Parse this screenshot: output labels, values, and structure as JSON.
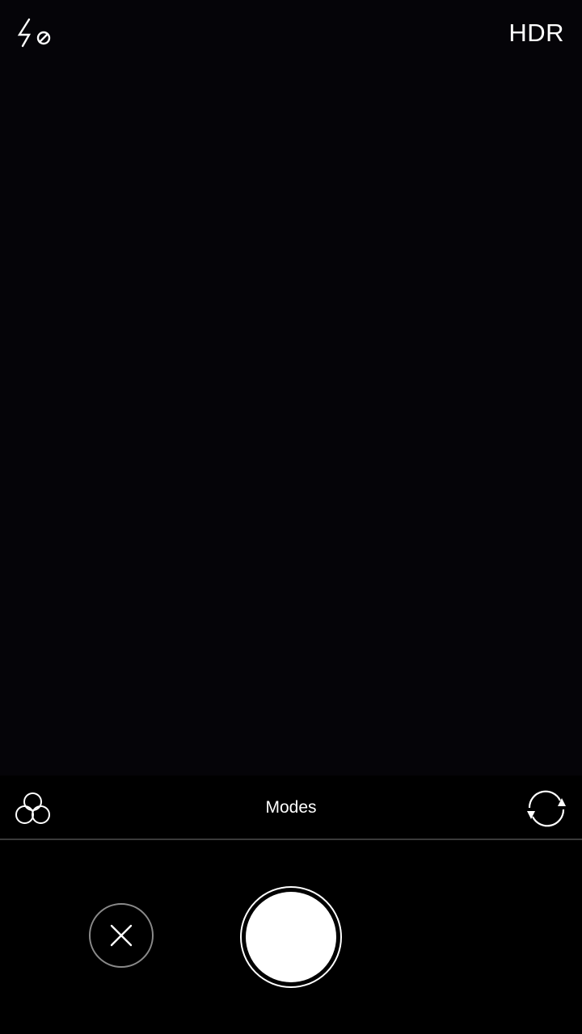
{
  "top_bar": {
    "flash_icon": "flash-off-icon",
    "hdr_label": "HDR"
  },
  "mode_bar": {
    "filters_icon": "filters-icon",
    "modes_label": "Modes",
    "switch_icon": "switch-camera-icon"
  },
  "controls": {
    "cancel_icon": "close-icon",
    "shutter_icon": "shutter-button"
  },
  "colors": {
    "background": "#000000",
    "viewfinder": "#050408",
    "foreground": "#ffffff",
    "divider": "#3a3a3a",
    "cancel_ring": "#8a8a8a"
  }
}
